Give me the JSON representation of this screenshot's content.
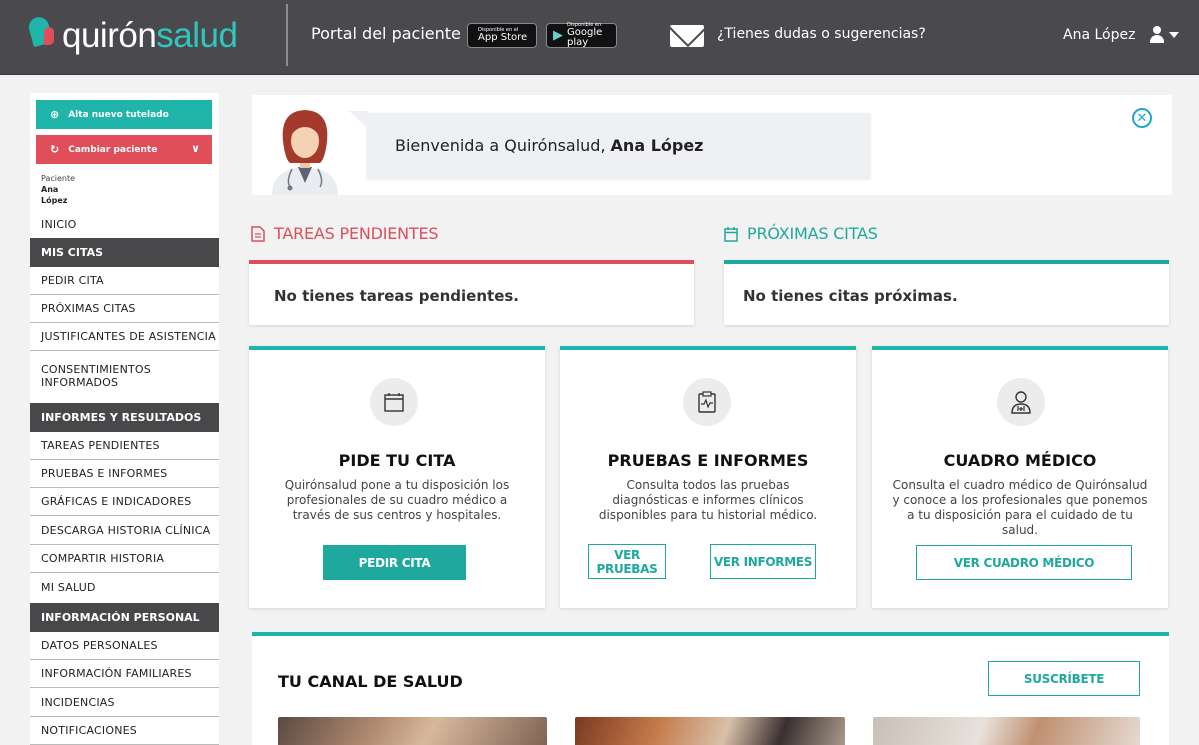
{
  "header": {
    "logo_part1": "quirón",
    "logo_part2": "salud",
    "portal": "Portal del paciente",
    "appstore_small": "Disponible en el",
    "appstore": "App Store",
    "googleplay_small": "Disponible en",
    "googleplay": "Google play",
    "feedback": "¿Tienes dudas o sugerencias?",
    "username": "Ana López"
  },
  "sidebar": {
    "alta_tutelado": "Alta nuevo tutelado",
    "cambiar_paciente": "Cambiar paciente",
    "paciente_label": "Paciente",
    "paciente_name1": "Ana",
    "paciente_name2": "López",
    "inicio": "INICIO",
    "section1": "MIS CITAS",
    "items1": [
      "PEDIR CITA",
      "PRÓXIMAS CITAS",
      "JUSTIFICANTES DE ASISTENCIA",
      "CONSENTIMIENTOS INFORMADOS"
    ],
    "section2": "INFORMES Y RESULTADOS",
    "items2": [
      "TAREAS PENDIENTES",
      "PRUEBAS E INFORMES",
      "GRÁFICAS E INDICADORES",
      "DESCARGA HISTORIA CLÍNICA",
      "COMPARTIR HISTORIA",
      "MI SALUD"
    ],
    "section3": "INFORMACIÓN PERSONAL",
    "items3": [
      "DATOS PERSONALES",
      "INFORMACIÓN FAMILIARES",
      "INCIDENCIAS",
      "NOTIFICACIONES"
    ]
  },
  "welcome": {
    "greeting": "Bienvenida a Quirónsalud, ",
    "name": "Ana López"
  },
  "tareas": {
    "title": "TAREAS PENDIENTES",
    "message": "No tienes tareas pendientes.",
    "color": "#d9505c"
  },
  "citas": {
    "title": "PRÓXIMAS CITAS",
    "message": "No tienes citas próximas.",
    "color": "#1fa89e"
  },
  "cards": [
    {
      "title": "PIDE TU CITA",
      "desc": "Quirónsalud pone a tu disposición los profesionales de su cuadro médico a través de sus centros y hospitales.",
      "buttons": [
        "PEDIR CITA"
      ]
    },
    {
      "title": "PRUEBAS E INFORMES",
      "desc": "Consulta todos las pruebas diagnósticas e informes clínicos disponibles para tu historial médico.",
      "buttons": [
        "VER PRUEBAS",
        "VER INFORMES"
      ]
    },
    {
      "title": "CUADRO MÉDICO",
      "desc": "Consulta el cuadro médico de Quirónsalud y conoce a los profesionales que ponemos a tu disposición para el cuidado de tu salud.",
      "buttons": [
        "VER CUADRO MÉDICO"
      ]
    }
  ],
  "canal": {
    "title": "TU CANAL DE SALUD",
    "subscribe": "SUSCRÍBETE"
  },
  "colors": {
    "teal": "#1fb5ab",
    "red": "#e04e5a",
    "header": "#4a4a4e"
  }
}
